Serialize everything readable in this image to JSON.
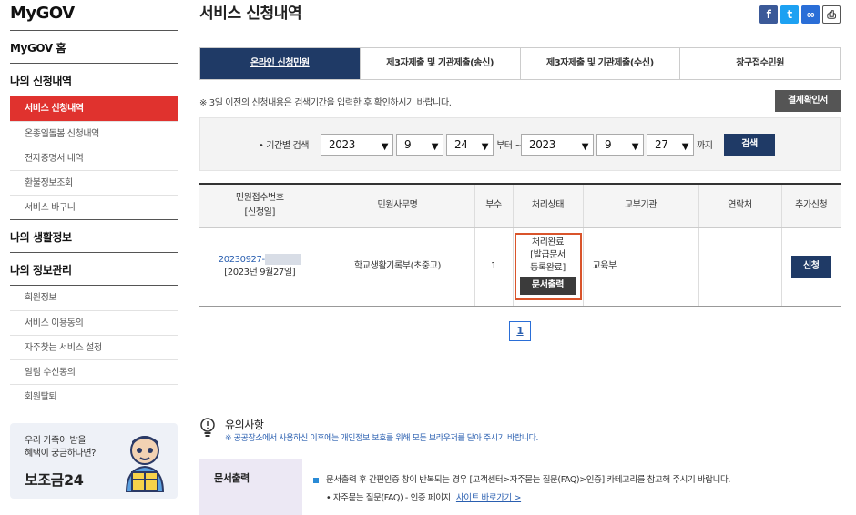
{
  "sidebar": {
    "logo": "MyGOV",
    "home": "MyGOV 홈",
    "sections": [
      {
        "title": "나의 신청내역",
        "items": [
          "서비스 신청내역",
          "온종일돌봄 신청내역",
          "전자증명서 내역",
          "환불정보조회",
          "서비스 바구니"
        ]
      },
      {
        "title": "나의 생활정보",
        "items": []
      },
      {
        "title": "나의 정보관리",
        "items": [
          "회원정보",
          "서비스 이용동의",
          "자주찾는 서비스 설정",
          "알림 수신동의",
          "회원탈퇴"
        ]
      }
    ],
    "banner": {
      "line1": "우리 가족이 받을",
      "line2": "혜택이 궁금하다면?",
      "brand": "보조금24"
    }
  },
  "main": {
    "title": "서비스 신청내역",
    "share_icons": [
      "facebook-icon",
      "twitter-icon",
      "link-icon",
      "print-icon"
    ],
    "tabs": [
      "온라인 신청민원",
      "제3자제출 및 기관제출(송신)",
      "제3자제출 및 기관제출(수신)",
      "창구접수민원"
    ],
    "active_tab": 0,
    "notice": "※ 3일 이전의 신청내용은 검색기간을 입력한 후 확인하시기 바랍니다.",
    "receipt_button": "결제확인서",
    "search": {
      "label": "• 기간별 검색",
      "from_year": "2023",
      "from_month": "9",
      "from_day": "24",
      "from_suffix": "부터 ~",
      "to_year": "2023",
      "to_month": "9",
      "to_day": "27",
      "to_suffix": "까지",
      "button": "검색"
    },
    "table": {
      "headers": [
        "민원접수번호",
        "[신청일]",
        "민원사무명",
        "부수",
        "처리상태",
        "교부기관",
        "연락처",
        "추가신청"
      ],
      "row": {
        "receipt_no": "20230927-",
        "date": "[2023년 9월27일]",
        "name": "학교생활기록부(초중고)",
        "copies": "1",
        "status_l1": "처리완료",
        "status_l2": "[발급문서",
        "status_l3": "등록완료]",
        "print_button": "문서출력",
        "agency": "교육부",
        "contact": "",
        "apply_button": "신청"
      }
    },
    "pagination": {
      "current": "1"
    },
    "caution": {
      "title": "유의사항",
      "note": "※ 공공장소에서 사용하신 이후에는 개인정보 보호를 위해 모든 브라우저를 닫아 주시기 바랍니다."
    },
    "info": {
      "heading": "문서출력",
      "line1": "문서출력 후 간편인증 창이 반복되는 경우 [고객센터>자주묻는 질문(FAQ)>인증] 카테고리를 참고해 주시기 바랍니다.",
      "line2": "• 자주묻는 질문(FAQ) - 인증 페이지",
      "link": "사이트 바로가기 >"
    }
  }
}
